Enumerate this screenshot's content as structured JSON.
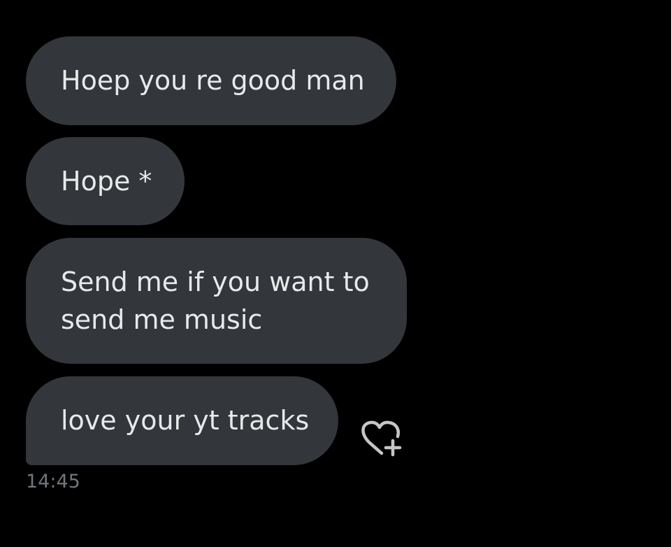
{
  "messages": [
    {
      "lines": [
        "Hoep you re good man"
      ]
    },
    {
      "lines": [
        "Hope *"
      ]
    },
    {
      "lines": [
        "Send me if you want to",
        "send me music"
      ]
    },
    {
      "lines": [
        "love your yt tracks"
      ]
    }
  ],
  "reaction": {
    "icon": "heart-plus-icon"
  },
  "timestamp": "14:45",
  "colors": {
    "background": "#000000",
    "bubble": "#33363a",
    "text": "#e7e9ea",
    "timestamp": "#71767b",
    "icon": "#c4c6c8"
  }
}
